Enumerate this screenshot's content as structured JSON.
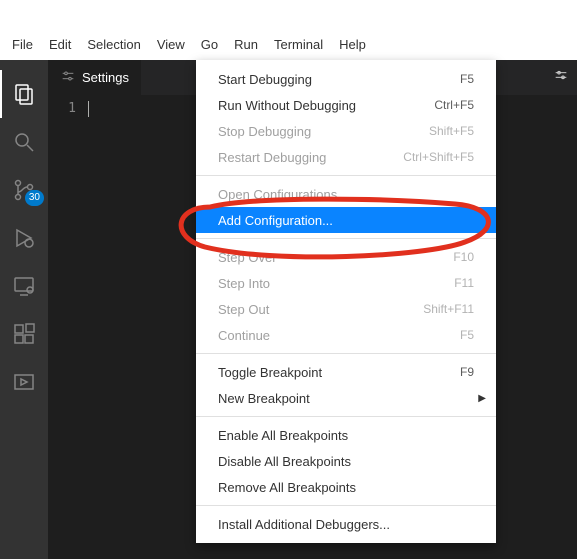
{
  "menubar": {
    "file": "File",
    "edit": "Edit",
    "selection": "Selection",
    "view": "View",
    "go": "Go",
    "run": "Run",
    "terminal": "Terminal",
    "help": "Help"
  },
  "tabs": {
    "settings": {
      "label": "Settings"
    }
  },
  "gutter": {
    "line1": "1"
  },
  "badge_count": "30",
  "run_menu": {
    "start_debugging": {
      "label": "Start Debugging",
      "shortcut": "F5"
    },
    "run_without_debugging": {
      "label": "Run Without Debugging",
      "shortcut": "Ctrl+F5"
    },
    "stop_debugging": {
      "label": "Stop Debugging",
      "shortcut": "Shift+F5"
    },
    "restart_debugging": {
      "label": "Restart Debugging",
      "shortcut": "Ctrl+Shift+F5"
    },
    "open_configurations": {
      "label": "Open Configurations"
    },
    "add_configuration": {
      "label": "Add Configuration..."
    },
    "step_over": {
      "label": "Step Over",
      "shortcut": "F10"
    },
    "step_into": {
      "label": "Step Into",
      "shortcut": "F11"
    },
    "step_out": {
      "label": "Step Out",
      "shortcut": "Shift+F11"
    },
    "continue": {
      "label": "Continue",
      "shortcut": "F5"
    },
    "toggle_breakpoint": {
      "label": "Toggle Breakpoint",
      "shortcut": "F9"
    },
    "new_breakpoint": {
      "label": "New Breakpoint"
    },
    "enable_all_breakpoints": {
      "label": "Enable All Breakpoints"
    },
    "disable_all_breakpoints": {
      "label": "Disable All Breakpoints"
    },
    "remove_all_breakpoints": {
      "label": "Remove All Breakpoints"
    },
    "install_additional_debuggers": {
      "label": "Install Additional Debuggers..."
    }
  }
}
